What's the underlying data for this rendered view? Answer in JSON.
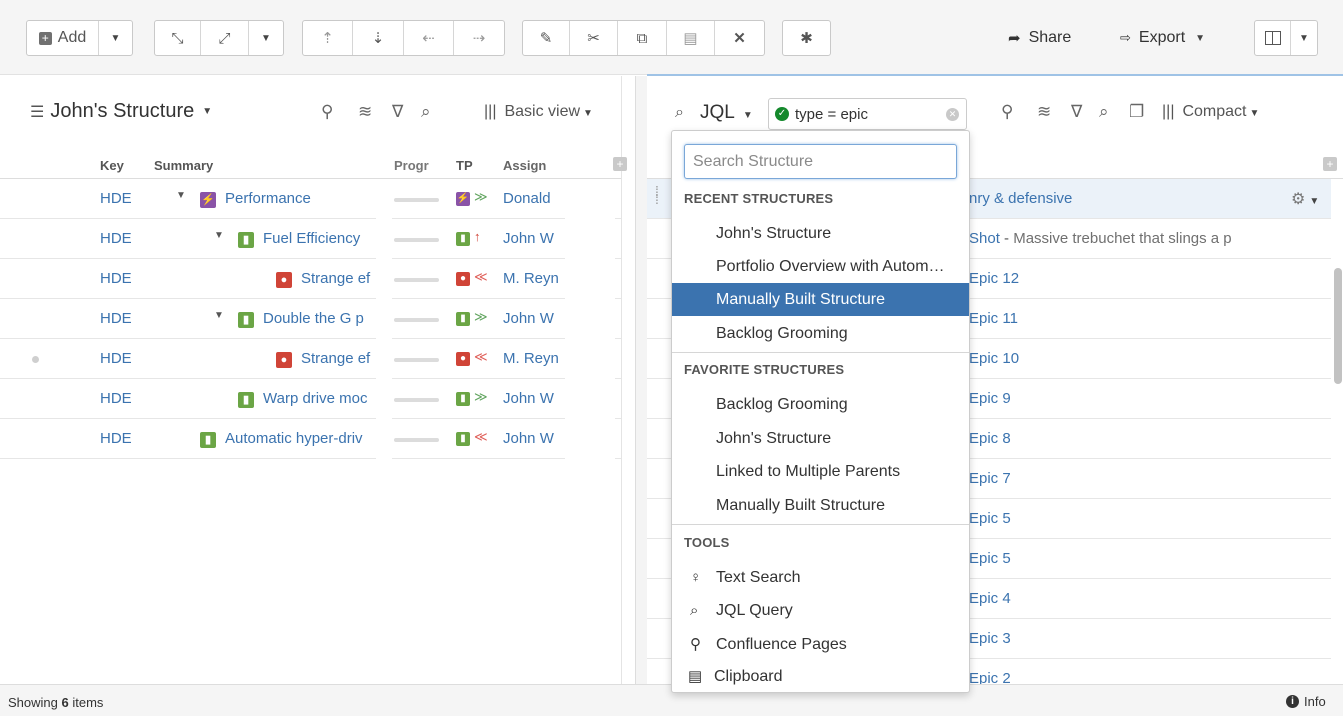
{
  "toolbar": {
    "add_label": "Add",
    "share_label": "Share",
    "export_label": "Export"
  },
  "left": {
    "title": "John's Structure",
    "view_label": "Basic view",
    "columns": {
      "key": "Key",
      "summary": "Summary",
      "progress": "Progr",
      "tp": "TP",
      "assignee": "Assign"
    },
    "rows": [
      {
        "key": "HDE",
        "summary": "Performance",
        "assignee": "Donald",
        "type_color": "#8a53a7",
        "pri": "≫",
        "pri_color": "#62a560"
      },
      {
        "key": "HDE",
        "summary": "Fuel Efficiency",
        "assignee": "John W",
        "type_color": "#6ba545",
        "pri": "↑",
        "pri_color": "#d04437"
      },
      {
        "key": "HDE",
        "summary": "Strange ef",
        "assignee": "M. Reyn",
        "type_color": "#d04437",
        "pri": "≪",
        "pri_color": "#e0605a"
      },
      {
        "key": "HDE",
        "summary": "Double the G p",
        "assignee": "John W",
        "type_color": "#6ba545",
        "pri": "≫",
        "pri_color": "#62a560"
      },
      {
        "key": "HDE",
        "summary": "Strange ef",
        "assignee": "M. Reyn",
        "type_color": "#d04437",
        "pri": "≪",
        "pri_color": "#e0605a"
      },
      {
        "key": "HDE",
        "summary": "Warp drive moc",
        "assignee": "John W",
        "type_color": "#6ba545",
        "pri": "≫",
        "pri_color": "#62a560"
      },
      {
        "key": "HDE",
        "summary": "Automatic hyper-driv",
        "assignee": "John W",
        "type_color": "#6ba545",
        "pri": "≪",
        "pri_color": "#e0605a"
      }
    ]
  },
  "right": {
    "jql_label": "JQL",
    "jql_value": "type = epic",
    "view_label": "Compact",
    "rows": [
      {
        "text": "nry & defensive",
        "desc": ""
      },
      {
        "text": "Shot",
        "desc": "Massive trebuchet that slings a p"
      },
      {
        "text": "Epic 12",
        "desc": ""
      },
      {
        "text": "Epic 11",
        "desc": ""
      },
      {
        "text": "Epic 10",
        "desc": ""
      },
      {
        "text": "Epic 9",
        "desc": ""
      },
      {
        "text": "Epic 8",
        "desc": ""
      },
      {
        "text": "Epic 7",
        "desc": ""
      },
      {
        "text": "Epic 5",
        "desc": ""
      },
      {
        "text": "Epic 5",
        "desc": ""
      },
      {
        "text": "Epic 4",
        "desc": ""
      },
      {
        "text": "Epic 3",
        "desc": ""
      },
      {
        "text": "Epic 2",
        "desc": ""
      }
    ]
  },
  "dropdown": {
    "search_placeholder": "Search Structure",
    "recent_header": "RECENT STRUCTURES",
    "recent": [
      "John's Structure",
      "Portfolio Overview with Autom…",
      "Manually Built Structure",
      "Backlog Grooming"
    ],
    "favorite_header": "FAVORITE STRUCTURES",
    "favorites": [
      "Backlog Grooming",
      "John's Structure",
      "Linked to Multiple Parents",
      "Manually Built Structure"
    ],
    "tools_header": "TOOLS",
    "tools": [
      "Text Search",
      "JQL Query",
      "Confluence Pages",
      "Clipboard"
    ]
  },
  "status": {
    "showing_prefix": "Showing",
    "count": "6",
    "suffix": "items",
    "info_label": "Info"
  },
  "colors": {
    "accent": "#3b73af",
    "selected_bg": "#3b73af"
  }
}
